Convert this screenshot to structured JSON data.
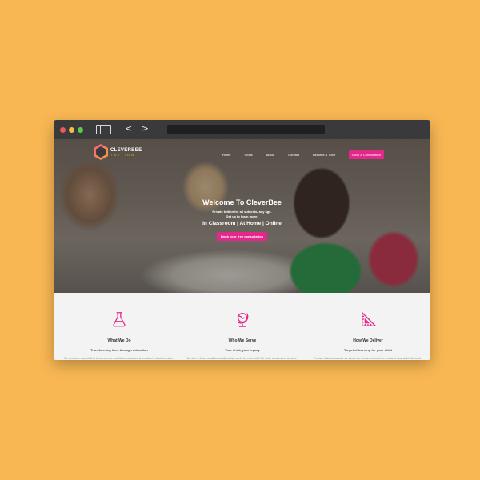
{
  "browser": {
    "nav_arrows": "< >"
  },
  "site": {
    "logo": {
      "name": "CLEVERBEE",
      "tagline": "TUITION"
    },
    "nav": {
      "items": [
        "Home",
        "Clubs",
        "About",
        "Contact",
        "Become A Tutor"
      ],
      "book_button": "Book A Consultation"
    },
    "hero": {
      "title": "Welcome To CleverBee",
      "subtitle_line1": "Private tuition for all subjects, any age.",
      "subtitle_line2": "Get us to learn more.",
      "modes": "In Classroom | At Home | Online",
      "cta": "Book your free consultation"
    },
    "features": [
      {
        "icon": "flask-icon",
        "title": "What We Do",
        "subtitle": "Transforming lives through education",
        "body": "We empower your child to become more confident engaged and proficient in their learning..."
      },
      {
        "icon": "globe-icon",
        "title": "Who We Serve",
        "subtitle": "Your child, your legacy",
        "body": "We offer 1:1 and small group tuition that works for your child. We pride ourselves in serving..."
      },
      {
        "icon": "set-square-icon",
        "title": "How We Deliver",
        "subtitle": "Targeted learning for your child",
        "body": "Through tailored support, we target our learning to meet the needs of your child. We work..."
      }
    ]
  },
  "colors": {
    "background": "#f8b753",
    "accent": "#e4278a",
    "browser_chrome": "#3a3a3c"
  }
}
